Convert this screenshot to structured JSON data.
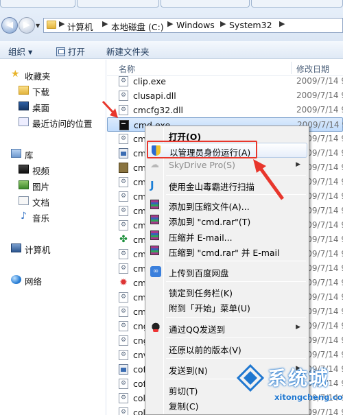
{
  "address_bar": {
    "crumbs": [
      "计算机",
      "本地磁盘 (C:)",
      "Windows",
      "System32"
    ]
  },
  "toolbar": {
    "organize_label": "组织 ▾",
    "open_label": "打开",
    "new_folder_label": "新建文件夹"
  },
  "nav_pane": {
    "favorites": {
      "label": "收藏夹",
      "items": [
        "下载",
        "桌面",
        "最近访问的位置"
      ]
    },
    "libraries": {
      "label": "库",
      "items": [
        "视频",
        "图片",
        "文档",
        "音乐"
      ]
    },
    "computer_label": "计算机",
    "network_label": "网络"
  },
  "file_list": {
    "columns": {
      "name": "名称",
      "modified": "修改日期"
    },
    "rows": [
      {
        "name": "clip.exe",
        "date": "2009/7/14 9",
        "icon": "exe-icon"
      },
      {
        "name": "clusapi.dll",
        "date": "2009/7/14 9",
        "icon": "dll-icon"
      },
      {
        "name": "cmcfg32.dll",
        "date": "2009/7/14 9",
        "icon": "dll-icon"
      },
      {
        "name": "cmd.exe",
        "date": "2009/7/14 9",
        "icon": "cmd-icon",
        "selected": true
      },
      {
        "name": "cm",
        "date": "2009/7/14 9",
        "icon": "dll-icon"
      },
      {
        "name": "cm",
        "date": "2009/7/14 9",
        "icon": "window-icon"
      },
      {
        "name": "cm",
        "date": "2009/7/14 9",
        "icon": "app-icon"
      },
      {
        "name": "cm",
        "date": "2009/7/14 9",
        "icon": "dll-icon"
      },
      {
        "name": "cm",
        "date": "2009/7/14 9",
        "icon": "dll-icon"
      },
      {
        "name": "cm",
        "date": "2009/7/14 9",
        "icon": "dll-icon"
      },
      {
        "name": "cm",
        "date": "2009/7/14 9",
        "icon": "dll-icon"
      },
      {
        "name": "cm",
        "date": "2009/7/14 9",
        "icon": "clover-icon"
      },
      {
        "name": "cm",
        "date": "2009/7/14 9",
        "icon": "dll-icon"
      },
      {
        "name": "cm",
        "date": "2009/7/14 9",
        "icon": "dll-icon"
      },
      {
        "name": "cm",
        "date": "2009/7/14 9",
        "icon": "colorful-icon"
      },
      {
        "name": "cm",
        "date": "2009/7/14 9",
        "icon": "dll-icon"
      },
      {
        "name": "cm",
        "date": "2009/7/14 9",
        "icon": "dll-icon"
      },
      {
        "name": "cng",
        "date": "2009/7/14 9",
        "icon": "dll-icon"
      },
      {
        "name": "cng",
        "date": "2009/7/14 9",
        "icon": "dll-icon"
      },
      {
        "name": "cnv",
        "date": "2009/7/14 9",
        "icon": "dll-icon"
      },
      {
        "name": "cof",
        "date": "2009/7/14 9",
        "icon": "window-icon"
      },
      {
        "name": "cof",
        "date": "2009/7/14 9",
        "icon": "dll-icon"
      },
      {
        "name": "col",
        "date": "2009/7/14 9",
        "icon": "dll-icon"
      },
      {
        "name": "col",
        "date": "2009/7/14 9",
        "icon": "dll-icon"
      }
    ]
  },
  "context_menu": {
    "open": "打开(O)",
    "run_as_admin": "以管理员身份运行(A)",
    "skydrive": "SkyDrive Pro(S)",
    "kingsoft_scan": "使用金山毒霸进行扫描",
    "add_archive": "添加到压缩文件(A)...",
    "add_cmd_rar": "添加到 \"cmd.rar\"(T)",
    "compress_email": "压缩并 E-mail...",
    "compress_cmd_email": "压缩到 \"cmd.rar\" 并 E-mail",
    "baidu_upload": "上传到百度网盘",
    "pin_taskbar": "锁定到任务栏(K)",
    "pin_start": "附到「开始」菜单(U)",
    "send_qq": "通过QQ发送到",
    "restore_prev": "还原以前的版本(V)",
    "send_to": "发送到(N)",
    "cut": "剪切(T)",
    "copy": "复制(C)"
  },
  "watermark": {
    "brand": "系统城",
    "url": "xitongcheng.com"
  },
  "colors": {
    "annotation_red": "#e8362c",
    "selection_blue": "#c1dcfc"
  }
}
